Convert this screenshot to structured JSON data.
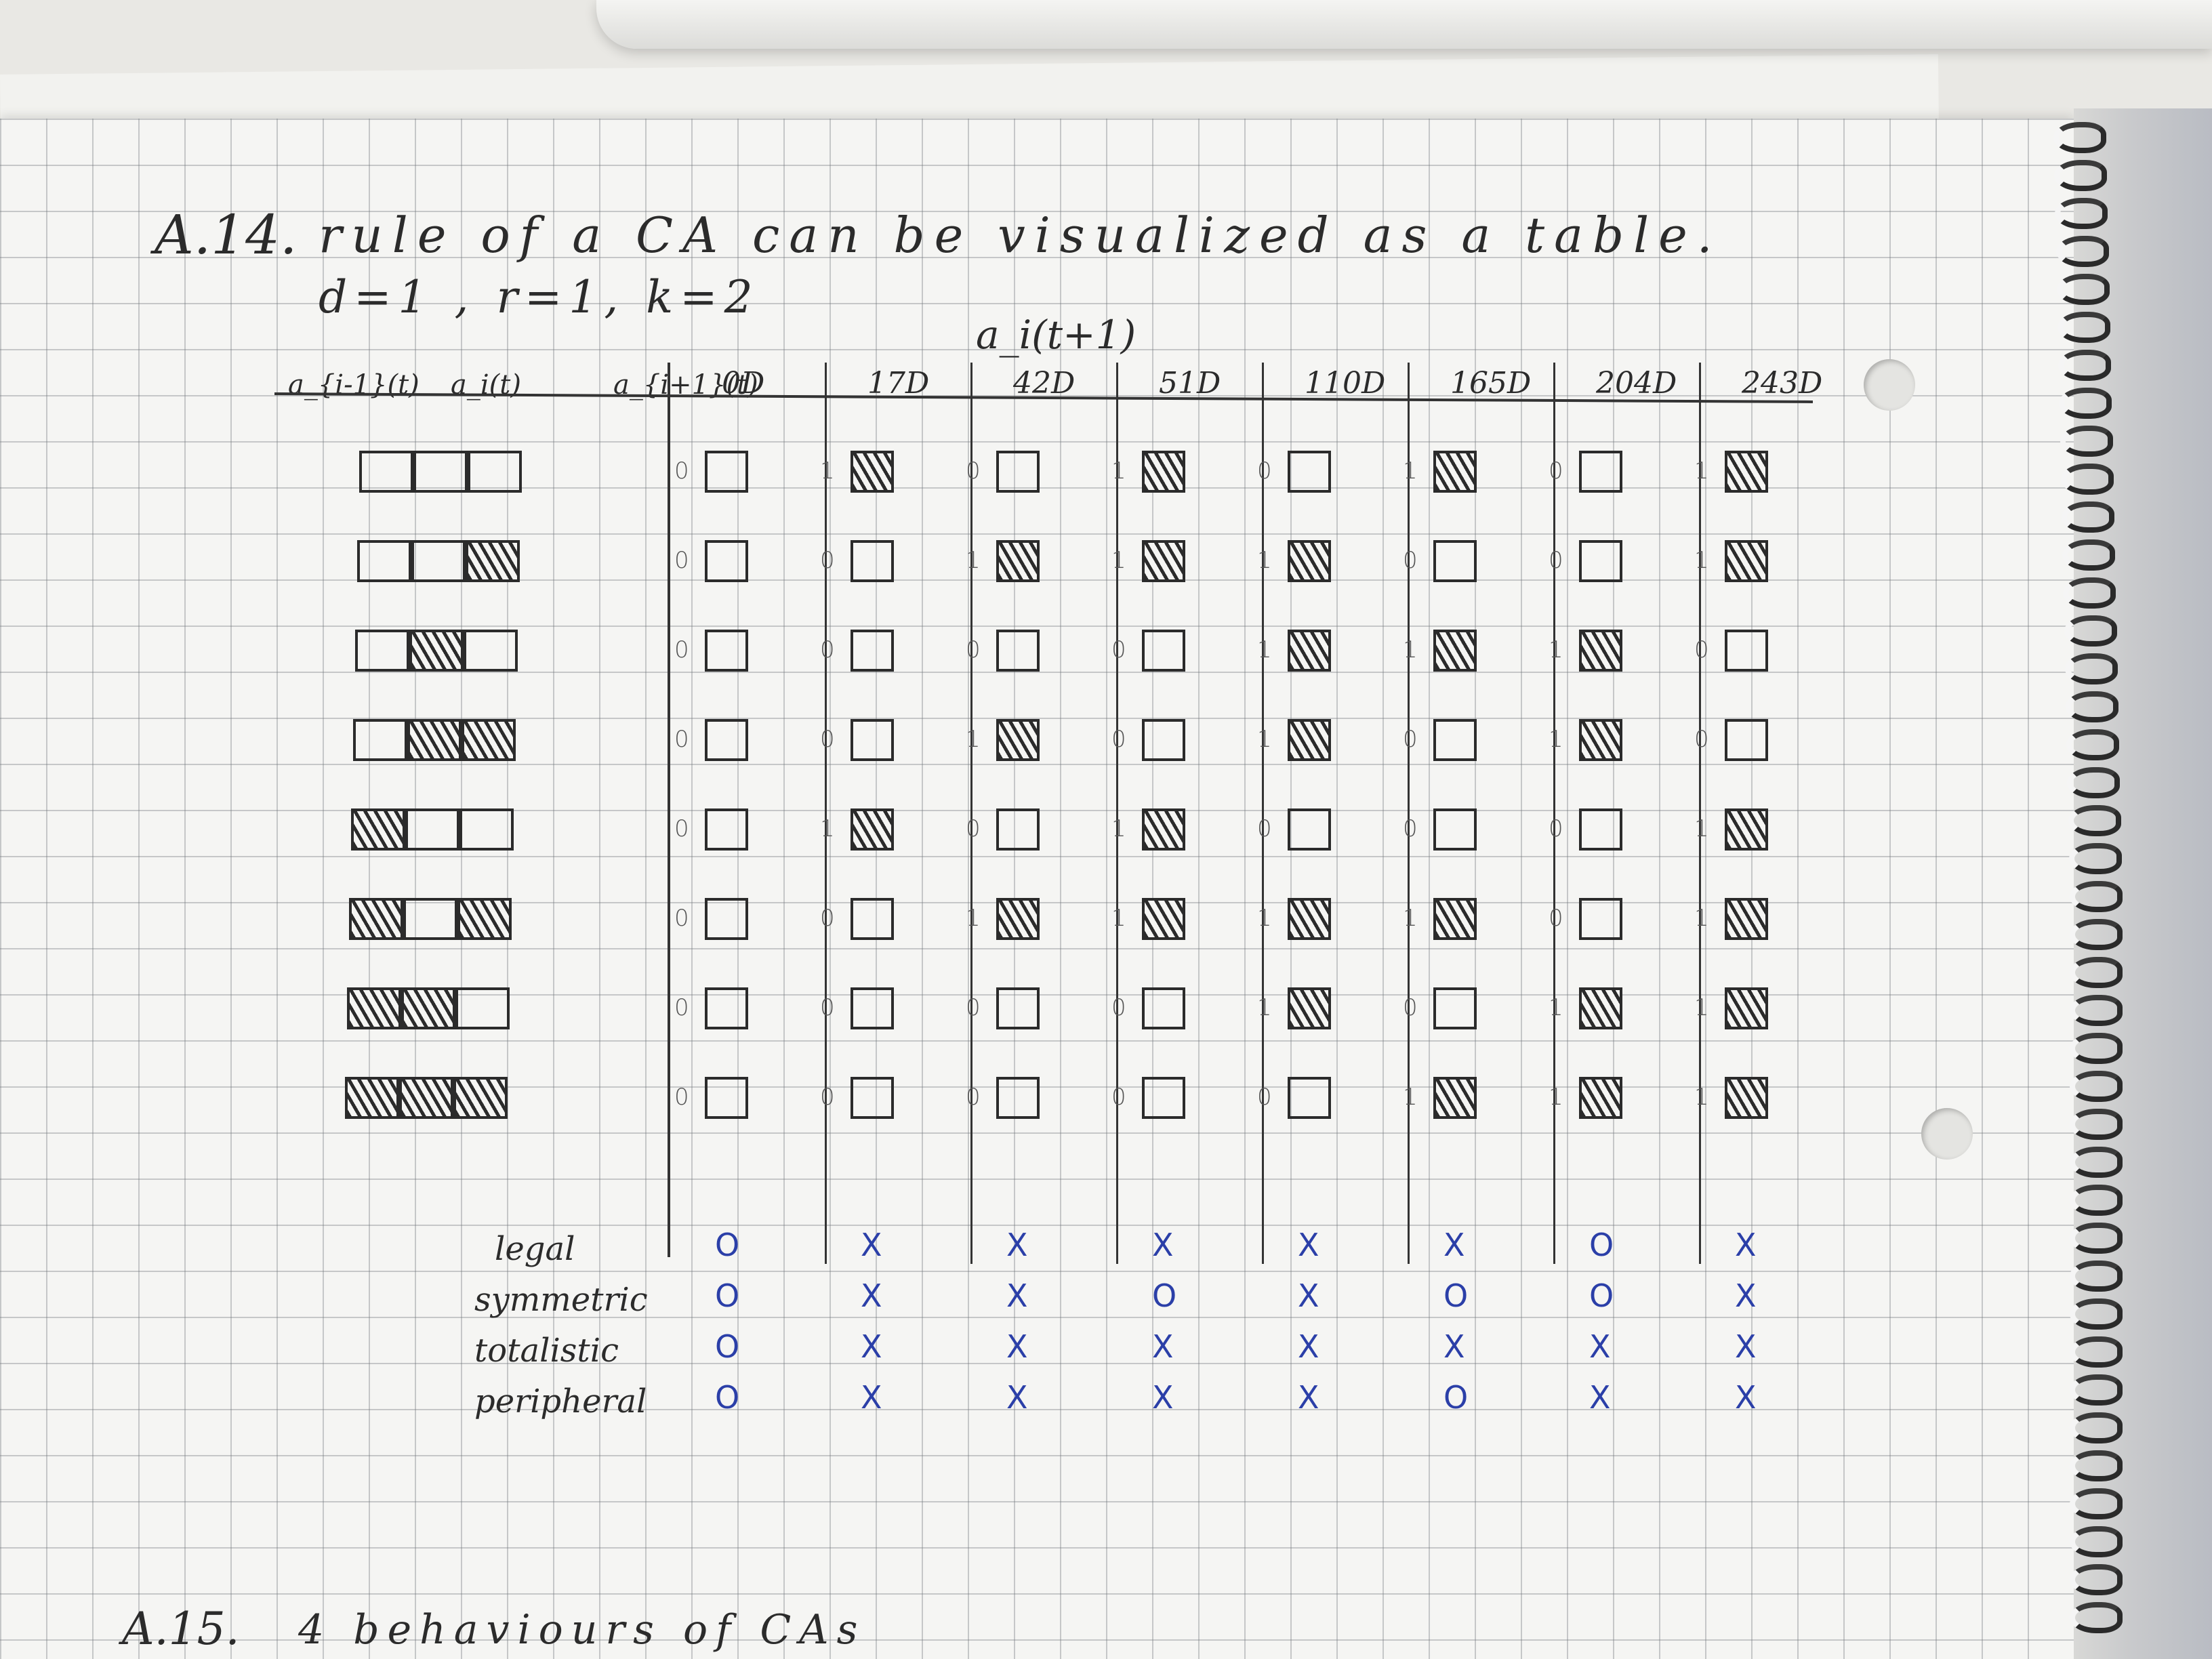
{
  "heading": {
    "number": "A.14.",
    "text": "rule of a CA can be visualized as a table.",
    "params": "d=1 , r=1, k=2"
  },
  "table": {
    "top_label": "a_i(t+1)",
    "neighborhood_headers": [
      "a_{i-1}(t)",
      "a_i(t)",
      "a_{i+1}(t)"
    ],
    "neighborhoods": [
      [
        0,
        0,
        0
      ],
      [
        0,
        0,
        1
      ],
      [
        0,
        1,
        0
      ],
      [
        0,
        1,
        1
      ],
      [
        1,
        0,
        0
      ],
      [
        1,
        0,
        1
      ],
      [
        1,
        1,
        0
      ],
      [
        1,
        1,
        1
      ]
    ],
    "rules": [
      {
        "label": "0D",
        "outputs": [
          0,
          0,
          0,
          0,
          0,
          0,
          0,
          0
        ]
      },
      {
        "label": "17D",
        "outputs": [
          1,
          0,
          0,
          0,
          1,
          0,
          0,
          0
        ]
      },
      {
        "label": "42D",
        "outputs": [
          0,
          1,
          0,
          1,
          0,
          1,
          0,
          0
        ]
      },
      {
        "label": "51D",
        "outputs": [
          1,
          1,
          0,
          0,
          1,
          1,
          0,
          0
        ]
      },
      {
        "label": "110D",
        "outputs": [
          0,
          1,
          1,
          1,
          0,
          1,
          1,
          0
        ]
      },
      {
        "label": "165D",
        "outputs": [
          1,
          0,
          1,
          0,
          0,
          1,
          0,
          1
        ]
      },
      {
        "label": "204D",
        "outputs": [
          0,
          0,
          1,
          1,
          0,
          0,
          1,
          1
        ]
      },
      {
        "label": "243D",
        "outputs": [
          1,
          1,
          0,
          0,
          1,
          1,
          1,
          1
        ]
      }
    ]
  },
  "properties": {
    "names": [
      "legal",
      "symmetric",
      "totalistic",
      "peripheral"
    ],
    "marks": [
      [
        "O",
        "O",
        "O",
        "O"
      ],
      [
        "X",
        "X",
        "X",
        "X"
      ],
      [
        "X",
        "X",
        "X",
        "X"
      ],
      [
        "X",
        "O",
        "X",
        "X"
      ],
      [
        "X",
        "X",
        "X",
        "X"
      ],
      [
        "X",
        "O",
        "X",
        "O"
      ],
      [
        "O",
        "O",
        "X",
        "X"
      ],
      [
        "X",
        "X",
        "X",
        "X"
      ]
    ]
  },
  "footer": {
    "number": "A.15.",
    "text": "4 behaviours of CAs"
  }
}
